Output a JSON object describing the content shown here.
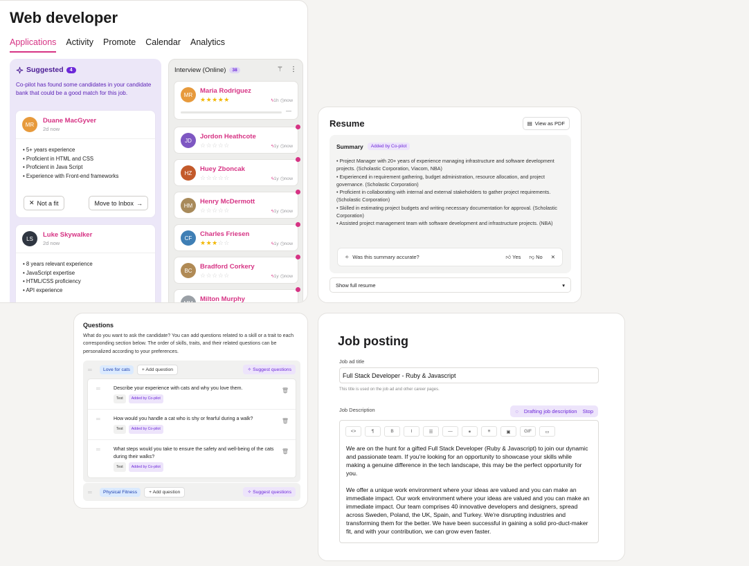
{
  "app": {
    "title": "Web developer",
    "tabs": [
      {
        "label": "Applications",
        "active": true
      },
      {
        "label": "Activity"
      },
      {
        "label": "Promote"
      },
      {
        "label": "Calendar"
      },
      {
        "label": "Analytics"
      }
    ]
  },
  "suggested": {
    "title": "Suggested",
    "count": "4",
    "description": "Co-pilot has found some candidates in your candidate bank that could be a good match for this job.",
    "candidates": [
      {
        "initials": "MR",
        "name": "Duane MacGyver",
        "meta": "2d  now",
        "avatar_color": "#e79a3c",
        "points": [
          "• 5+ years experience",
          "• Proficient in HTML and CSS",
          "• Proficient in Java Script",
          "• Experience with Front-end frameworks"
        ],
        "not_fit": "Not a fit",
        "move": "Move to Inbox"
      },
      {
        "initials": "LS",
        "name": "Luke Skywalker",
        "meta": "2d  now",
        "avatar_color": "#2f3641",
        "points": [
          "• 8 years relevant experience",
          "• JavaScript expertise",
          "• HTML/CSS proficiency",
          "• API experience"
        ]
      }
    ]
  },
  "interview": {
    "title": "Interview (Online)",
    "count": "38",
    "candidates": [
      {
        "initials": "MR",
        "name": "Maria Rodriguez",
        "stars": "★★★★★",
        "off": "",
        "time": "1h",
        "ago": "now",
        "color": "#e79a3c"
      },
      {
        "initials": "JD",
        "name": "Jordon Heathcote",
        "stars": "",
        "off": "☆☆☆☆☆",
        "time": "1y",
        "ago": "now",
        "color": "#7e57c2"
      },
      {
        "initials": "HZ",
        "name": "Huey Zboncak",
        "stars": "",
        "off": "☆☆☆☆☆",
        "time": "1y",
        "ago": "now",
        "color": "#c35a2b"
      },
      {
        "initials": "HM",
        "name": "Henry McDermott",
        "stars": "",
        "off": "☆☆☆☆☆",
        "time": "1y",
        "ago": "now",
        "color": "#a88a5a"
      },
      {
        "initials": "CF",
        "name": "Charles Friesen",
        "stars": "★★★",
        "off": "☆☆",
        "time": "1y",
        "ago": "now",
        "color": "#3f7fb5"
      },
      {
        "initials": "BC",
        "name": "Bradford Corkery",
        "stars": "",
        "off": "☆☆☆☆☆",
        "time": "1y",
        "ago": "now",
        "color": "#b08a55"
      },
      {
        "initials": "MM",
        "name": "Milton Murphy",
        "stars": "",
        "off": "",
        "time": "",
        "ago": "",
        "color": "#9aa0a6"
      }
    ]
  },
  "resume": {
    "title": "Resume",
    "pdf_label": "View as PDF",
    "summary_label": "Summary",
    "added_tag": "Added by Co-pilot",
    "summary_lines": [
      "• Project Manager with 20+ years of experience managing infrastructure and software development projects. (Scholastic Corporation, Viacom, NBA)",
      "• Experienced in requirement gathering, budget administration, resource allocation, and project governance. (Scholastic Corporation)",
      "• Proficient in collaborating with internal and external stakeholders to gather project requirements. (Scholastic Corporation)",
      "• Skilled in estimating project budgets and writing necessary documentation for approval. (Scholastic Corporation)",
      "• Assisted project management team with software development and infrastructure projects. (NBA)"
    ],
    "accurate_q": "Was this summary accurate?",
    "yes": "Yes",
    "no": "No",
    "show_full": "Show full resume"
  },
  "questions": {
    "title": "Questions",
    "description": "What do you want to ask the candidate? You can add questions related to a skill or a trait to each corresponding section below. The order of skills, traits, and their related questions can be personalized according to your preferences.",
    "add_label": "+ Add question",
    "suggest_label": "Suggest questions",
    "sections": [
      {
        "category": "Love for cats",
        "items": [
          {
            "text": "Describe your experience with cats and why you love them.",
            "tag": "Test",
            "co": "Added by Co-pilot"
          },
          {
            "text": "How would you handle a cat who is shy or fearful during a walk?",
            "tag": "Test",
            "co": "Added by Co-pilot"
          },
          {
            "text": "What steps would you take to ensure the safety and well-being of the cats during their walks?",
            "tag": "Test",
            "co": "Added by Co-pilot"
          }
        ]
      },
      {
        "category": "Physical Fitness",
        "items": []
      }
    ]
  },
  "job": {
    "title": "Job posting",
    "ad_title_label": "Job ad title",
    "ad_title_value": "Full Stack Developer - Ruby & Javascript",
    "ad_hint": "This title is used on the job ad and other career pages.",
    "desc_label": "Job Description",
    "drafting": "Drafting job description",
    "stop": "Stop",
    "toolbar": [
      "<>",
      "¶",
      "B",
      "I",
      "☰",
      "—",
      "⚭",
      "≡",
      "▣",
      "GIF",
      "▭"
    ],
    "body": [
      "We are on the hunt for a gifted Full Stack Developer (Ruby & Javascript) to join our dynamic and passionate team. If you're looking for an opportunity to showcase your skills while making a genuine difference in the tech landscape, this may be the perfect opportunity for you.",
      "We offer a unique work environment where your ideas are valued and you can make an immediate impact. Our work environment where your ideas are valued and you can make an immediate impact. Our team comprises 40 innovative developers and designers, spread across Sweden, Poland, the UK, Spain, and Turkey. We're disrupting industries and transforming them for the better. We have been successful in gaining a solid pro-duct-maker fit, and with your contribution, we can grow even faster."
    ]
  }
}
